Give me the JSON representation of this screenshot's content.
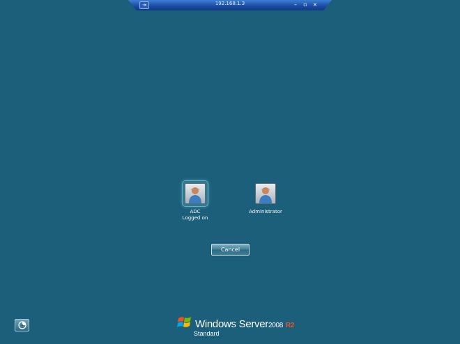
{
  "rdp_bar": {
    "title": "192.168.1.3",
    "pin_icon": "pin-icon",
    "minimize_label": "–",
    "restore_label": "▫",
    "close_label": "×"
  },
  "users": [
    {
      "name": "ADC",
      "status": "Logged on",
      "selected": true
    },
    {
      "name": "Administrator",
      "status": "",
      "selected": false
    }
  ],
  "cancel_label": "Cancel",
  "branding": {
    "product": "Windows Server",
    "version": "2008",
    "release": "R2",
    "edition": "Standard"
  },
  "colors": {
    "background": "#1b5f7a",
    "r2_accent": "#e8552a"
  }
}
